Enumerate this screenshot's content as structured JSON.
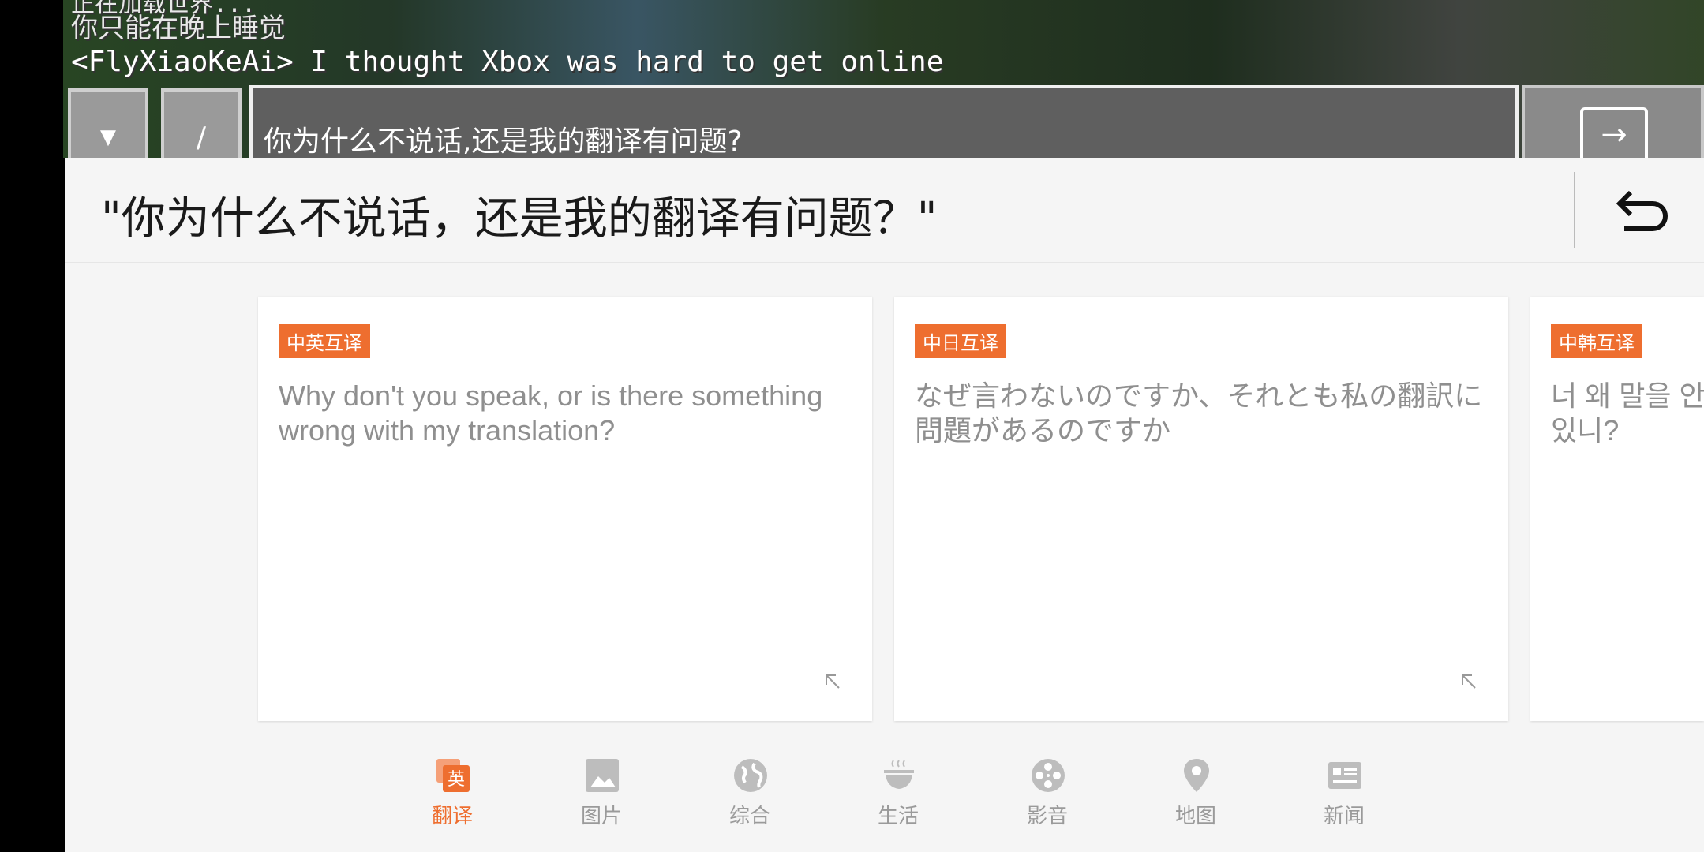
{
  "game": {
    "chat_top": "正在加载世界...",
    "chat_line_1": "你只能在晚上睡觉",
    "chat_line_2": "<FlyXiaoKeAi> I thought Xbox was hard to get online",
    "dropdown_glyph": "▼",
    "slash_glyph": "/",
    "input_value": "你为什么不说话,还是我的翻译有问题?",
    "send_glyph": "→"
  },
  "translate": {
    "query": "\"你为什么不说话，还是我的翻译有问题？\"",
    "undo_icon": "undo-icon",
    "cards": [
      {
        "tag": "中英互译",
        "text": "Why don't you speak, or is there something wrong with my translation?"
      },
      {
        "tag": "中日互译",
        "text": "なぜ言わないのですか、それとも私の翻訳に問題があるのですか"
      },
      {
        "tag": "中韩互译",
        "text": "너 왜 말을 안 하니? 아니면 내 번역에 문제가 있니?"
      }
    ]
  },
  "nav": {
    "active_color": "#ee6e2f",
    "inactive_color": "#9a9a9a",
    "items": [
      {
        "label": "翻译",
        "icon": "translate-icon"
      },
      {
        "label": "图片",
        "icon": "image-icon"
      },
      {
        "label": "综合",
        "icon": "globe-icon"
      },
      {
        "label": "生活",
        "icon": "food-bowl-icon"
      },
      {
        "label": "影音",
        "icon": "film-reel-icon"
      },
      {
        "label": "地图",
        "icon": "map-pin-icon"
      },
      {
        "label": "新闻",
        "icon": "news-card-icon"
      }
    ]
  }
}
